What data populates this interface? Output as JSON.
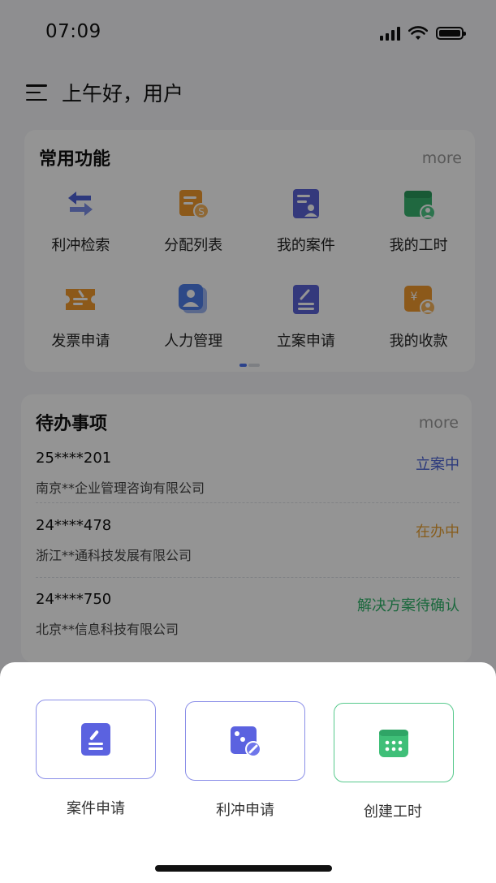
{
  "status": {
    "time": "07:09"
  },
  "header": {
    "greeting": "上午好，用户"
  },
  "common": {
    "title": "常用功能",
    "more": "more",
    "items": [
      {
        "label": "利冲检索",
        "icon": "swap-arrows-icon",
        "color": "#4f63d8"
      },
      {
        "label": "分配列表",
        "icon": "allocation-list-icon",
        "color": "#f29a2e"
      },
      {
        "label": "我的案件",
        "icon": "my-cases-icon",
        "color": "#5b63d6"
      },
      {
        "label": "我的工时",
        "icon": "work-hours-icon",
        "color": "#37b36f"
      },
      {
        "label": "发票申请",
        "icon": "invoice-ticket-icon",
        "color": "#f29a2e"
      },
      {
        "label": "人力管理",
        "icon": "people-icon",
        "color": "#4f7ee8"
      },
      {
        "label": "立案申请",
        "icon": "case-filing-icon",
        "color": "#5b63d6"
      },
      {
        "label": "我的收款",
        "icon": "payment-yen-icon",
        "color": "#f29a2e"
      }
    ]
  },
  "todo": {
    "title": "待办事项",
    "more": "more",
    "items": [
      {
        "code": "25****201",
        "company": "南京**企业管理咨询有限公司",
        "status": "立案中",
        "color": "#4a63d6"
      },
      {
        "code": "24****478",
        "company": "浙江**通科技发展有限公司",
        "status": "在办中",
        "color": "#e8a033"
      },
      {
        "code": "24****750",
        "company": "北京**信息科技有限公司",
        "status": "解决方案待确认",
        "color": "#2fb46a"
      }
    ]
  },
  "sheet": {
    "actions": [
      {
        "label": "案件申请",
        "icon": "case-apply-icon",
        "border": "#8b8fe8"
      },
      {
        "label": "利冲申请",
        "icon": "conflict-apply-icon",
        "border": "#8b8fe8"
      },
      {
        "label": "创建工时",
        "icon": "calendar-icon",
        "border": "#57c98c"
      }
    ]
  }
}
